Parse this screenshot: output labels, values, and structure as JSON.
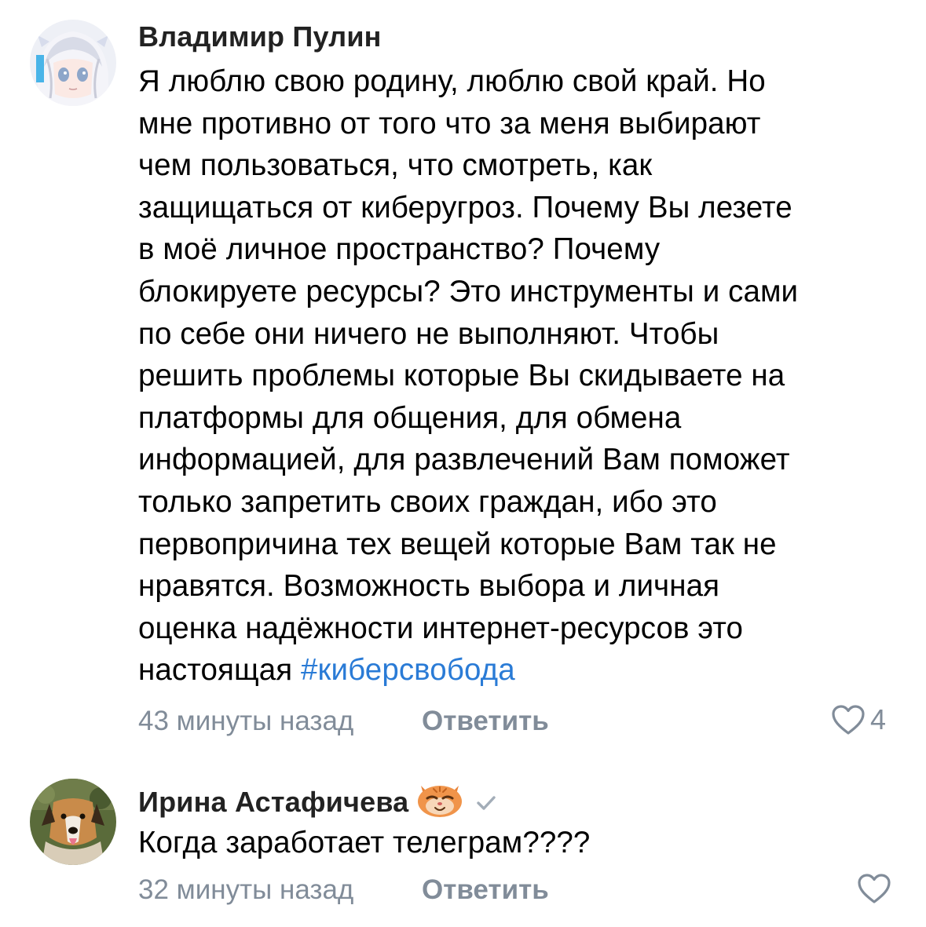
{
  "comments": [
    {
      "author": "Владимир Пулин",
      "text": "Я люблю свою родину, люблю свой край. Но\nмне противно от того что за меня выбирают\nчем пользоваться, что смотреть, как\nзащищаться от киберугроз. Почему Вы лезете\nв моё личное пространство? Почему\nблокируете ресурсы? Это инструменты и сами\nпо себе они ничего не выполняют. Чтобы\nрешить проблемы которые Вы скидываете на\nплатформы для общения, для обмена\nинформацией, для развлечений Вам поможет\nтолько запретить своих граждан, ибо это\nпервопричина тех вещей которые Вам так не\nнравятся. Возможность выбора и личная\nоценка надёжности интернет-ресурсов это\nнастоящая ",
      "hashtag": "#киберсвобода",
      "time": "43 минуты назад",
      "reply_label": "Ответить",
      "likes": "4",
      "avatar_icon": "anime-girl-avatar"
    },
    {
      "author": "Ирина Астафичева",
      "text": "Когда заработает телеграм????",
      "time": "32 минуты назад",
      "reply_label": "Ответить",
      "likes": "",
      "avatar_icon": "dog-photo-avatar",
      "badge_icon": "cat-emoji-icon",
      "verified_icon": "checkmark-icon"
    }
  ],
  "colors": {
    "meta": "#818c99",
    "hashtag": "#2a7bd6",
    "text": "#000000"
  }
}
